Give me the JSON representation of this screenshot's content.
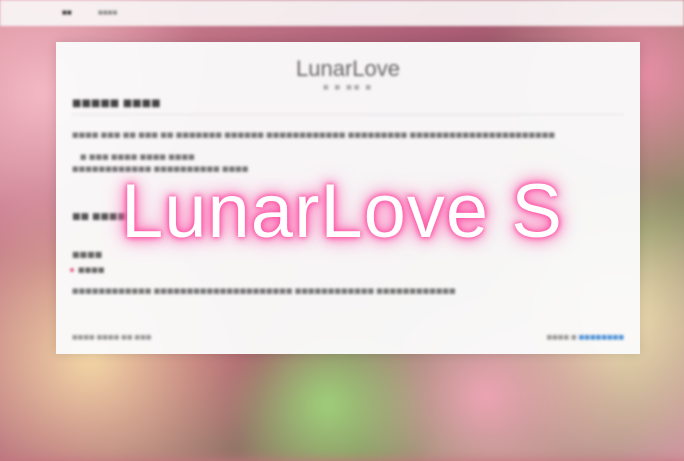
{
  "topbar": {
    "brand": "■■",
    "link": "■■■■"
  },
  "card": {
    "site_title": "LunarLove",
    "site_subtitle": "■ ■ ■■ ■",
    "post_title": "■■■■■ ■■■■",
    "para1": "■■■■ ■■■ ■■ ■■■ ■■ ■■■■■■■ ■■■■■■ ■■■■■■■■■■■■ ■■■■■■■■■ ■■■■■■■■■■■■■■■■■■■■■■",
    "para2": "■ ■■■ ■■■■ ■■■■ ■■■■",
    "para3": "■■■■■■■■■■■■ ■■■■■■■■■■ ■■■■",
    "section_title": "■■ ■■■■■",
    "subsection": "■■■■",
    "list_item": "■■■■",
    "para4": "■■■■■■■■■■■■ ■■■■■■■■■■■■■■■■■■■■■ ■■■■■■■■■■■■ ■■■■■■■■■■■■",
    "footer_left": "■■■■ ■■■■ ■■ ■■■",
    "footer_right_prefix": "■■■■ ■ ",
    "footer_right_link": "■■■■■■■■"
  },
  "overlay": {
    "title": "LunarLove S"
  },
  "colors": {
    "accent_pink": "#ff4fa3",
    "link_blue": "#4d8fd6"
  }
}
